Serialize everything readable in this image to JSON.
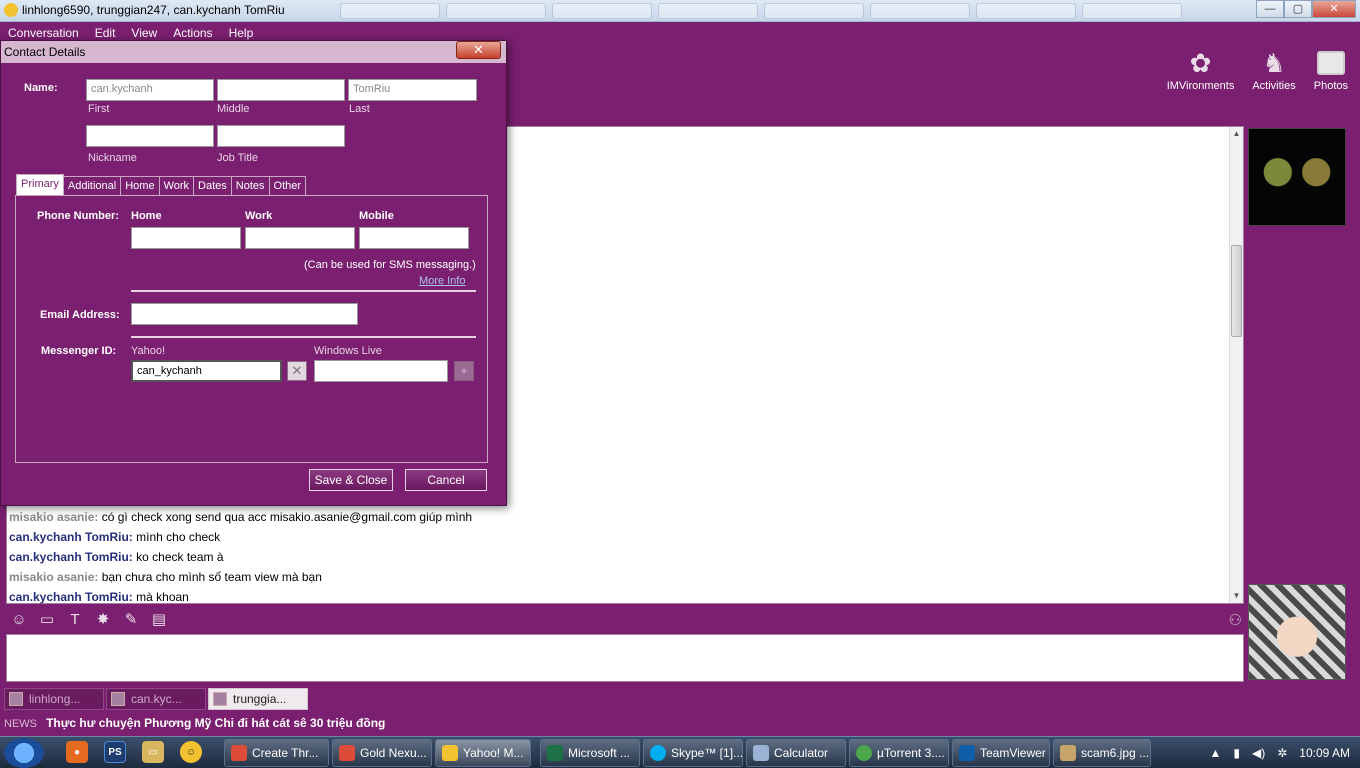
{
  "window": {
    "title": "linhlong6590, trunggian247, can.kychanh TomRiu",
    "minimize": "—",
    "maximize": "▢",
    "close": "✕"
  },
  "menu": [
    "Conversation",
    "Edit",
    "View",
    "Actions",
    "Help"
  ],
  "toolbar": {
    "imvironments": "IMVironments",
    "activities": "Activities",
    "photos": "Photos"
  },
  "messages": [
    {
      "sender": "misakio asanie:",
      "text": "có gì check xong send qua acc misakio.asanie@gmail.com giúp mình",
      "style": "gray"
    },
    {
      "sender": "can.kychanh TomRiu:",
      "text": "mình cho check",
      "style": "blue"
    },
    {
      "sender": "can.kychanh TomRiu:",
      "text": "ko check team à",
      "style": "blue"
    },
    {
      "sender": "misakio asanie:",
      "text": "bạn chưa cho mình số team view mà bạn",
      "style": "gray"
    },
    {
      "sender": "can.kychanh TomRiu:",
      "text": "mà khoan",
      "style": "blue"
    }
  ],
  "conv_tabs": [
    "linhlong...",
    "can.kyc...",
    "trunggia..."
  ],
  "news": {
    "label": "NEWS",
    "headline": "Thực hư chuyện Phương Mỹ Chi đi hát cát sê 30 triệu đồng"
  },
  "dialog": {
    "title": "Contact Details",
    "close": "✕",
    "name_label": "Name:",
    "first_value": "can.kychanh",
    "first_label": "First",
    "middle_label": "Middle",
    "last_value": "TomRiu",
    "last_label": "Last",
    "nickname_label": "Nickname",
    "jobtitle_label": "Job Title",
    "tabs": [
      "Primary",
      "Additional",
      "Home",
      "Work",
      "Dates",
      "Notes",
      "Other"
    ],
    "phone_label": "Phone Number:",
    "phone_cols": [
      "Home",
      "Work",
      "Mobile"
    ],
    "sms_note": "(Can be used for SMS messaging.)",
    "more_info": "More Info",
    "email_label": "Email Address:",
    "messenger_label": "Messenger ID:",
    "yahoo_label": "Yahoo!",
    "yahoo_value": "can_kychanh",
    "wlive_label": "Windows Live",
    "remove_icon": "✕",
    "add_icon": "+",
    "save": "Save & Close",
    "cancel": "Cancel"
  },
  "taskbar": {
    "quick": [
      "PS"
    ],
    "tasks": [
      {
        "label": "Create Thr...",
        "color": "#dd4b39"
      },
      {
        "label": "Gold Nexu...",
        "color": "#dd4b39"
      },
      {
        "label": "Yahoo! M...",
        "color": "#f2c230"
      },
      {
        "label": "Microsoft ...",
        "color": "#1e7145"
      },
      {
        "label": "Skype™ [1]...",
        "color": "#00aff0"
      },
      {
        "label": "Calculator",
        "color": "#9ab3d4"
      },
      {
        "label": "µTorrent 3....",
        "color": "#4ca64c"
      },
      {
        "label": "TeamViewer",
        "color": "#0e5ea8"
      },
      {
        "label": "scam6.jpg ...",
        "color": "#c7a46a"
      }
    ],
    "clock": "10:09 AM"
  },
  "colors": {
    "app_purple": "#7b1f70",
    "sender_blue": "#27307a",
    "sender_gray": "#888888"
  }
}
